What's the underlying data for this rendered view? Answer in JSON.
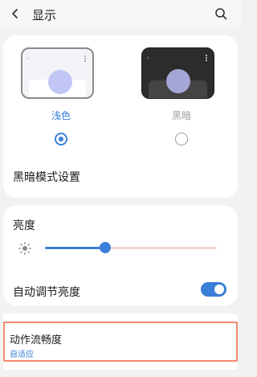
{
  "header": {
    "title": "显示",
    "back_icon": "back-arrow-icon",
    "search_icon": "search-icon"
  },
  "theme": {
    "options": [
      {
        "label": "浅色",
        "selected": true
      },
      {
        "label": "黑暗",
        "selected": false
      }
    ],
    "dark_mode_settings_label": "黑暗模式设置"
  },
  "brightness": {
    "title": "亮度",
    "level_percent": 35,
    "auto_label": "自动调节亮度",
    "auto_enabled": true
  },
  "motion": {
    "title": "动作流畅度",
    "subtitle": "自适应"
  },
  "colors": {
    "accent": "#3b7fd8",
    "highlight_border": "#f08a6e"
  }
}
